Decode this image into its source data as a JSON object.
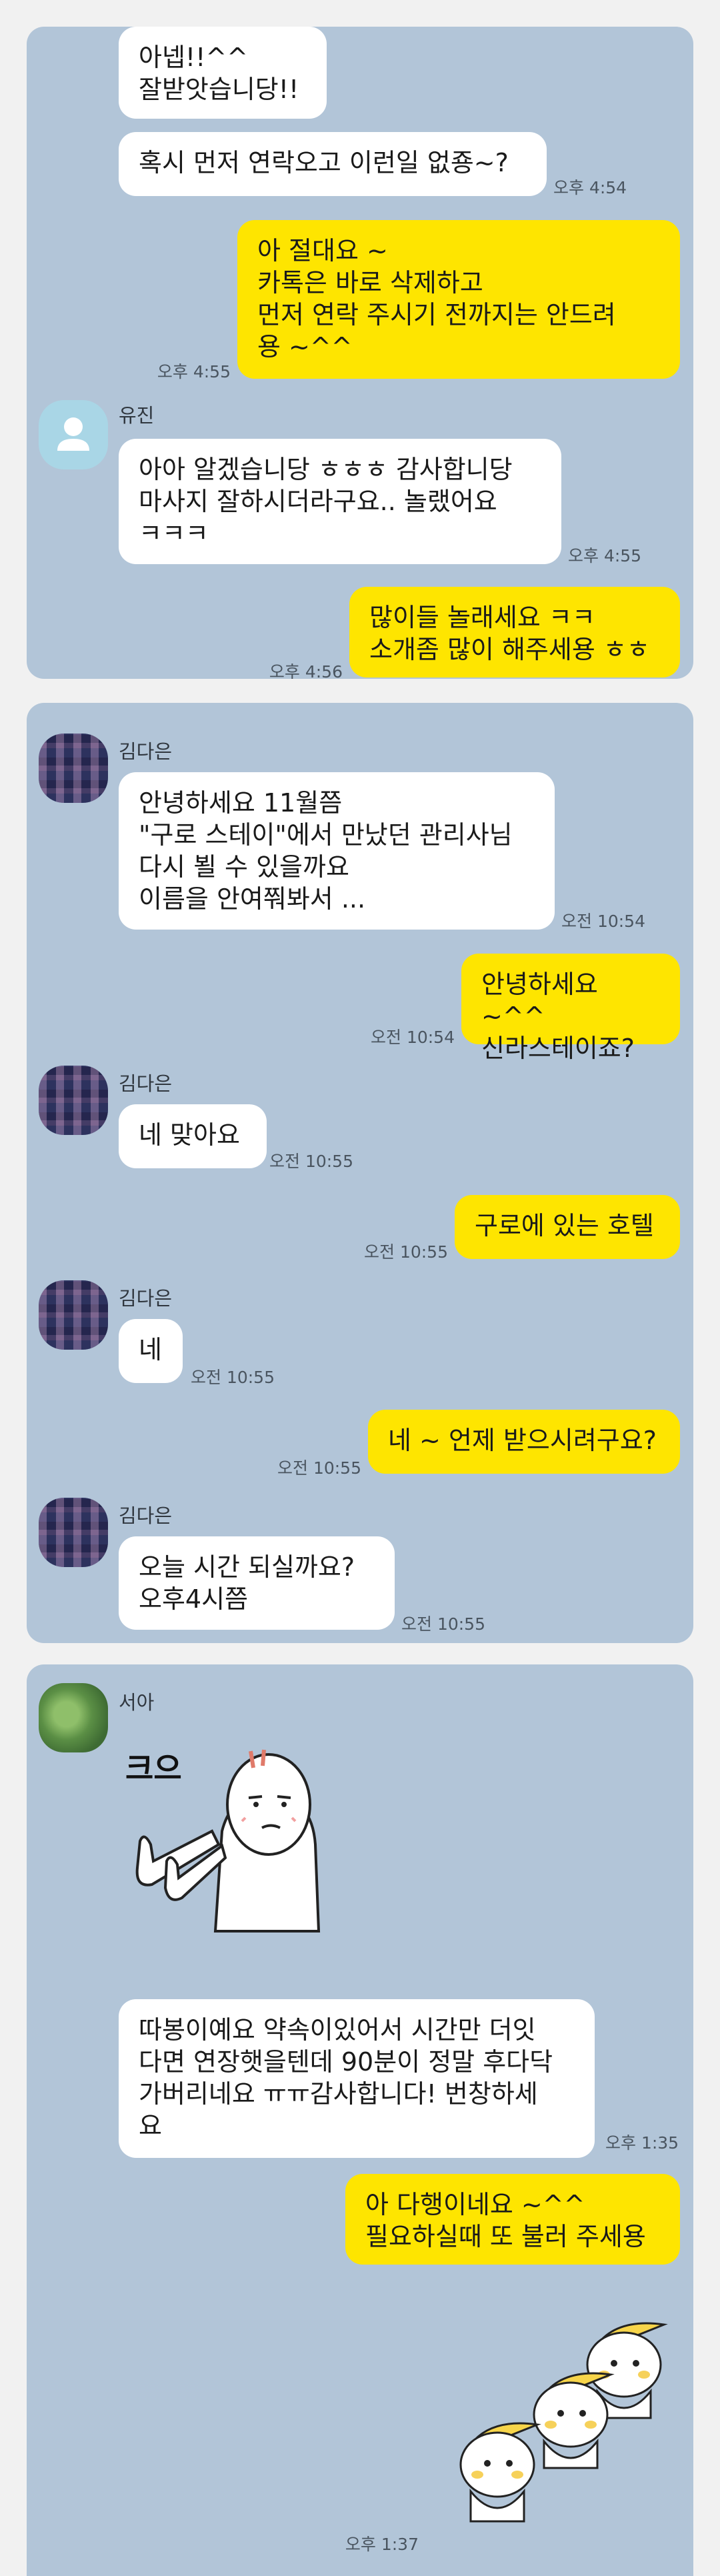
{
  "panel1": {
    "msgs": [
      {
        "text": "아넵!!^^\n잘받앗습니당!!"
      },
      {
        "text": "혹시 먼저 연락오고 이런일 없죵~?",
        "time": "오후 4:54"
      },
      {
        "text": "아 절대요 ~\n카톡은 바로 삭제하고\n먼저 연락 주시기 전까지는 안드려\n용 ~^^",
        "time": "오후 4:55"
      },
      {
        "text": "아아 알겠습니당 ㅎㅎㅎ 감사합니당\n마사지 잘하시더라구요.. 놀랬어요\nㅋㅋㅋ",
        "time": "오후 4:55"
      },
      {
        "text": "많이들 놀래세요 ㅋㅋ\n소개좀 많이 해주세용 ㅎㅎ",
        "time": "오후 4:56"
      }
    ],
    "sender": "유진"
  },
  "panel2": {
    "sender": "김다은",
    "msgs": [
      {
        "text": "안녕하세요 11월쯤\n\"구로 스테이\"에서 만났던 관리사님\n다시 뵐 수 있을까요\n이름을 안여쭤봐서 ...",
        "time": "오전 10:54"
      },
      {
        "text": "안녕하세요 ~^^\n신라스테이죠?",
        "time": "오전 10:54"
      },
      {
        "text": "네 맞아요",
        "time": "오전 10:55"
      },
      {
        "text": "구로에 있는 호텔",
        "time": "오전 10:55"
      },
      {
        "text": "네",
        "time": "오전 10:55"
      },
      {
        "text": "네 ~ 언제 받으시려구요?",
        "time": "오전 10:55"
      },
      {
        "text": "오늘  시간 되실까요?\n오후4시쯤",
        "time": "오전 10:55"
      }
    ]
  },
  "panel3": {
    "sender": "서아",
    "sticker_text": "크으",
    "msgs": [
      {
        "text": "따봉이예요 약속이있어서 시간만 더잇\n다면 연장햇을텐데 90분이 정말 후다닥\n가버리네요 ㅠㅠ감사합니다! 번창하세\n요",
        "time": "오후 1:35"
      },
      {
        "text": "아 다행이네요 ~^^\n필요하실때 또 불러 주세용",
        "time": "오후 1:37"
      }
    ]
  },
  "colors": {
    "chat_bg": "#b2c5d8",
    "incoming": "#ffffff",
    "outgoing": "#fee500",
    "page_bg": "#f1f1f1"
  }
}
